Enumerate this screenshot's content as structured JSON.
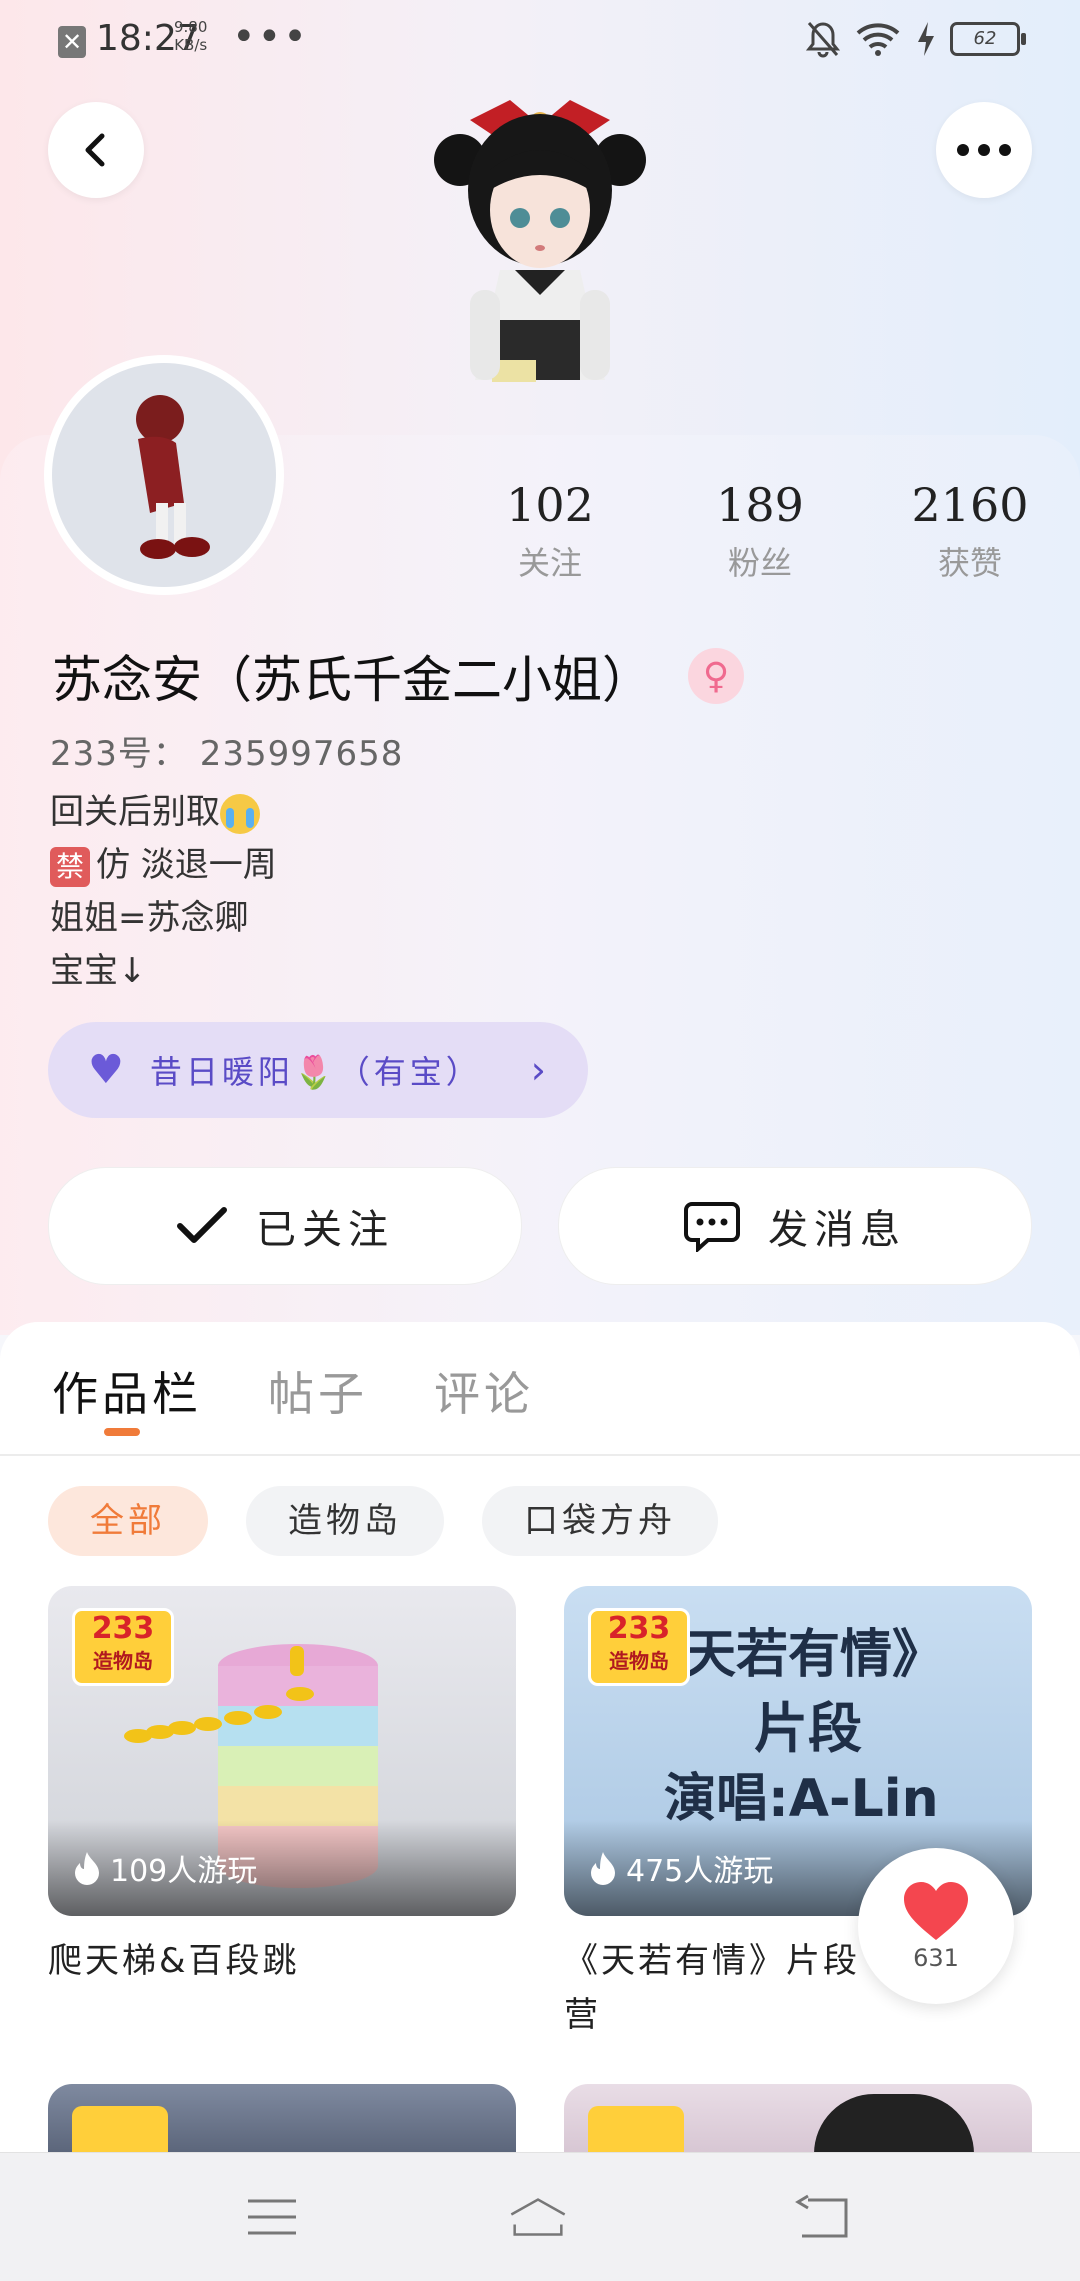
{
  "status_bar": {
    "time": "18:27",
    "speed_value": "9.80",
    "speed_unit": "KB/s",
    "more": "•••",
    "battery": "62"
  },
  "header": {
    "back_icon": "chevron-left-icon",
    "more_icon": "more-dots-icon"
  },
  "profile": {
    "stats": [
      {
        "value": "102",
        "label": "关注"
      },
      {
        "value": "189",
        "label": "粉丝"
      },
      {
        "value": "2160",
        "label": "获赞"
      }
    ],
    "name": "苏念安（苏氏千金二小姐）",
    "gender_symbol": "♀",
    "id_line": "233号：  235997658",
    "bio": [
      "回关后别取",
      "仿   淡退一周",
      "姐姐=苏念卿",
      "宝宝↓"
    ],
    "ban_badge": "禁",
    "family": {
      "text": "昔日暖阳🌷（有宝）"
    },
    "follow_button": "已关注",
    "message_button": "发消息"
  },
  "tabs": [
    {
      "label": "作品栏",
      "active": true
    },
    {
      "label": "帖子",
      "active": false
    },
    {
      "label": "评论",
      "active": false
    }
  ],
  "filters": [
    {
      "label": "全部",
      "active": true
    },
    {
      "label": "造物岛",
      "active": false
    },
    {
      "label": "口袋方舟",
      "active": false
    }
  ],
  "games": [
    {
      "logo_top": "233",
      "logo_bottom": "造物岛",
      "players": "109人游玩",
      "title": "爬天梯&百段跳"
    },
    {
      "logo_top": "233",
      "logo_bottom": "造物岛",
      "players": "475人游玩",
      "title": "《天若有情》片段\n营",
      "thumb_text": [
        "天若有情》",
        "片段",
        "演唱:A-Lin"
      ]
    }
  ],
  "like_fab": {
    "count": "631"
  },
  "colors": {
    "accent": "#f07b3a",
    "family_bg": "#e4ddf6",
    "family_text": "#5a4bc6"
  }
}
